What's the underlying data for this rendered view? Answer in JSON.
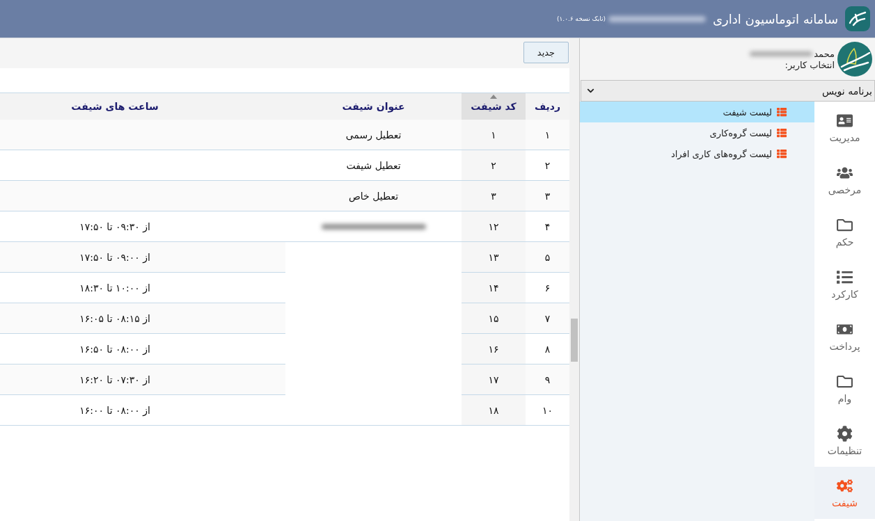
{
  "header": {
    "title": "سامانه اتوماسیون اداری",
    "title_blurred": true,
    "version": "(تابک نسخه ۱.۰.۶)"
  },
  "user": {
    "name": "محمد",
    "name_blurred": true,
    "prompt": "انتخاب کاربر:"
  },
  "role_select": {
    "value": "برنامه نویس"
  },
  "submenu": [
    {
      "label": "لیست شیفت",
      "selected": true
    },
    {
      "label": "لیست گروه‌کاری",
      "selected": false
    },
    {
      "label": "لیست گروه‌های کاری افراد",
      "selected": false
    }
  ],
  "nav": [
    {
      "label": "مدیریت",
      "kind": "card",
      "selected": false
    },
    {
      "label": "مرخصی",
      "kind": "people",
      "selected": false
    },
    {
      "label": "حکم",
      "kind": "folder",
      "selected": false
    },
    {
      "label": "کارکرد",
      "kind": "list",
      "selected": false
    },
    {
      "label": "پرداخت",
      "kind": "bill",
      "selected": false
    },
    {
      "label": "وام",
      "kind": "folder",
      "selected": false
    },
    {
      "label": "تنظیمات",
      "kind": "gear",
      "selected": false
    },
    {
      "label": "شیفت",
      "kind": "gears",
      "selected": true
    }
  ],
  "toolbar": {
    "buttons": [
      "جدید"
    ]
  },
  "table": {
    "columns": [
      {
        "label": "ردیف",
        "sorted": false
      },
      {
        "label": "کد شیفت",
        "sorted": true
      },
      {
        "label": "عنوان شیفت",
        "sorted": false
      },
      {
        "label": "ساعت های شیفت",
        "sorted": false
      }
    ],
    "rows": [
      {
        "row": "۱",
        "code": "۱",
        "title": "تعطیل رسمی"
      },
      {
        "row": "۲",
        "code": "۲",
        "title": "تعطیل شیفت"
      },
      {
        "row": "۳",
        "code": "۳",
        "title": "تعطیل خاص"
      },
      {
        "row": "۴",
        "code": "۱۲",
        "title_blurred": true,
        "hours": "از ۰۹:۳۰ تا ۱۷:۵۰"
      },
      {
        "row": "۵",
        "code": "۱۳",
        "hours": "از ۰۹:۰۰ تا ۱۷:۵۰"
      },
      {
        "row": "۶",
        "code": "۱۴",
        "hours": "از ۱۰:۰۰ تا ۱۸:۳۰"
      },
      {
        "row": "۷",
        "code": "۱۵",
        "hours": "از ۰۸:۱۵ تا ۱۶:۰۵"
      },
      {
        "row": "۸",
        "code": "۱۶",
        "hours": "از ۰۸:۰۰ تا ۱۶:۵۰"
      },
      {
        "row": "۹",
        "code": "۱۷",
        "hours": "از ۰۷:۳۰ تا ۱۶:۲۰"
      },
      {
        "row": "۱۰",
        "code": "۱۸",
        "hours": "از ۰۸:۰۰ تا ۱۶:۰۰"
      }
    ]
  }
}
